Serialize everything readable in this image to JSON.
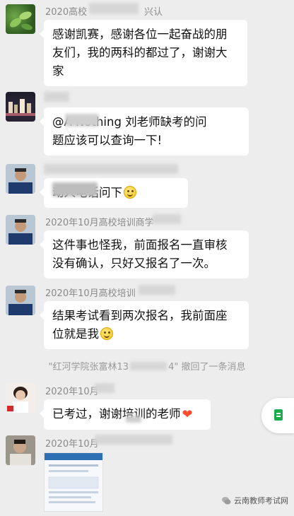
{
  "messages": [
    {
      "sender": "2020高校",
      "sender_suffix": "兴认",
      "lines": [
        "感谢凯赛，感谢各位一起奋战的朋",
        "友们，我的两科的都过了，谢谢大",
        "家"
      ]
    },
    {
      "sender": "",
      "lines": [
        "@A      Nothing  刘老师缺考的问",
        "题应该可以查询一下!"
      ]
    },
    {
      "sender": "",
      "lines": [
        "     动人电话问下"
      ]
    },
    {
      "sender": "2020年10月高校培训商学",
      "lines": [
        "这件事也怪我，前面报名一直审核",
        "没有确认，只好又报名了一次。"
      ]
    },
    {
      "sender": "2020年10月高校培训",
      "lines": [
        "结果考试看到两次报名，我前面座",
        "位就是我"
      ]
    },
    {
      "sender": "2020年10月",
      "lines": [
        "已考过，谢谢培训的老师"
      ]
    },
    {
      "sender": "2020年10月"
    }
  ],
  "recall_notice": {
    "prefix": "\"红河学院张富林13",
    "suffix": "4\" 撤回了一条消息"
  },
  "watermark": "云南教师考试网",
  "colors": {
    "background": "#ededed",
    "bubble": "#ffffff",
    "meta_text": "#8a8a8a",
    "accent_green": "#1bac4b"
  },
  "icons": {
    "smile": "smile-emoji-icon",
    "heart": "orange-heart-icon",
    "doc": "document-icon"
  }
}
